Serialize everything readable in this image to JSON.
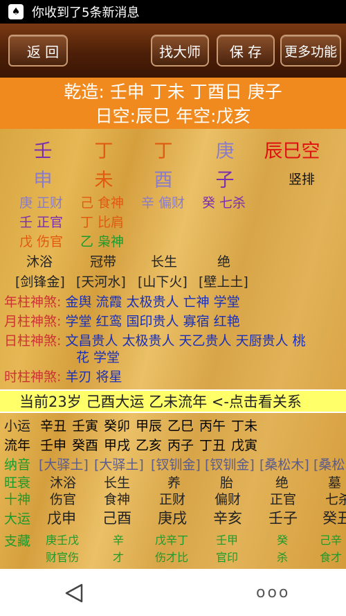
{
  "status": {
    "icon": "notification-icon",
    "message": "你收到了5条新消息"
  },
  "toolbar": {
    "back": "返 回",
    "find_master": "找大师",
    "save": "保 存",
    "more": "更多功能"
  },
  "header": {
    "line1": "乾造: 壬申 丁未 丁酉日 庚子",
    "line2": "日空:辰巳 年空:戊亥"
  },
  "pillars": {
    "stems": [
      "壬",
      "丁",
      "丁",
      "庚"
    ],
    "empty": "辰巳空",
    "branches": [
      "申",
      "未",
      "酉",
      "子"
    ],
    "vertical": "竖排"
  },
  "hidden": {
    "col0": [
      "庚 正财",
      "壬 正官",
      "戊 伤官"
    ],
    "col1": [
      "己 食神",
      "丁 比肩",
      "乙 枭神"
    ],
    "col2": [
      "辛 偏财"
    ],
    "col3": [
      "癸 七杀"
    ]
  },
  "life_stage": [
    "沐浴",
    "冠带",
    "长生",
    "绝"
  ],
  "nayin": [
    "[剑锋金]",
    "[天河水]",
    "[山下火]",
    "[壁上土]"
  ],
  "shensha": {
    "year_label": "年柱神煞:",
    "year": "金舆 流霞 太极贵人 亡神 学堂",
    "month_label": "月柱神煞:",
    "month": "学堂 红鸾 国印贵人 寡宿 红艳",
    "day_label": "日柱神煞:",
    "day1": "文昌贵人 太极贵人 天乙贵人 天厨贵人 桃",
    "day2": "花 学堂",
    "hour_label": "时柱神煞:",
    "hour": "羊刃 将星"
  },
  "current": "当前23岁 己酉大运 乙未流年  <-点击看关系",
  "table": {
    "xiaoyun_label": "小运",
    "xiaoyun": [
      "辛丑",
      "壬寅",
      "癸卯",
      "甲辰",
      "乙巳",
      "丙午",
      "丁未"
    ],
    "liunian_label": "流年",
    "liunian": [
      "壬申",
      "癸酉",
      "甲戌",
      "乙亥",
      "丙子",
      "丁丑",
      "戊寅"
    ],
    "nayin_label": "纳音",
    "nayin": [
      "[大驿土]",
      "[大驿土]",
      "[钗钏金]",
      "[钗钏金]",
      "[桑松木]",
      "[桑松"
    ],
    "wangshuai_label": "旺衰",
    "wangshuai": [
      "沐浴",
      "长生",
      "养",
      "胎",
      "绝",
      "墓"
    ],
    "shishen_label": "十神",
    "shishen": [
      "伤官",
      "食神",
      "正财",
      "偏财",
      "正官",
      "七杀"
    ],
    "dayun_label": "大运",
    "dayun": [
      "戊申",
      "己酉",
      "庚戌",
      "辛亥",
      "壬子",
      "癸丑"
    ],
    "zhicang_label": "支藏",
    "zhicang": [
      "庚壬戊",
      "辛",
      "戊辛丁",
      "壬甲",
      "癸",
      "己辛"
    ],
    "zhicang2": [
      "财官伤",
      "才",
      "伤才比",
      "官印",
      "杀",
      "食才"
    ]
  },
  "nav": {
    "more": "ooo"
  }
}
